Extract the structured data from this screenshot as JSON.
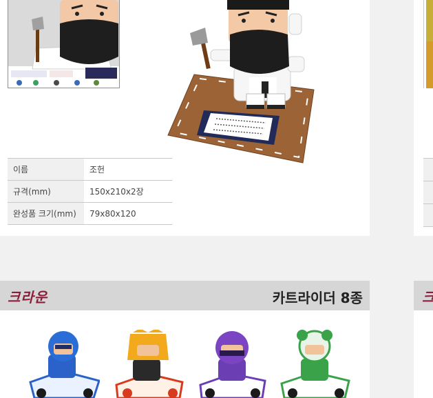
{
  "product": {
    "spec_rows": [
      {
        "key": "이름",
        "value": "조헌"
      },
      {
        "key": "규격(mm)",
        "value": "150x210x2장"
      },
      {
        "key": "완성품 크기(mm)",
        "value": "79x80x120"
      }
    ]
  },
  "section": {
    "brand": "크라운",
    "title": "카트라이더 8종",
    "right_brand_fragment": "크"
  },
  "colors": {
    "brand": "#8b1f3b",
    "section_bar": "#d6d6d6",
    "page_bg": "#f1f1f1"
  },
  "icons": [
    "axe-icon",
    "scroll-icon",
    "mat-icon"
  ],
  "karts": [
    {
      "name": "blue-racer"
    },
    {
      "name": "yellow-racer"
    },
    {
      "name": "purple-racer"
    },
    {
      "name": "green-racer"
    }
  ]
}
